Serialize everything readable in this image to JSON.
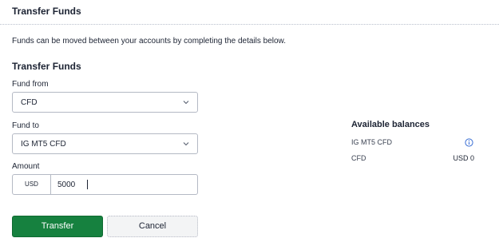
{
  "header": {
    "title": "Transfer Funds"
  },
  "description": "Funds can be moved between your accounts by completing the details below.",
  "form": {
    "section_title": "Transfer Funds",
    "fund_from": {
      "label": "Fund from",
      "value": "CFD"
    },
    "fund_to": {
      "label": "Fund to",
      "value": "IG MT5 CFD"
    },
    "amount": {
      "label": "Amount",
      "currency": "USD",
      "value": "5000"
    },
    "transfer_label": "Transfer",
    "cancel_label": "Cancel"
  },
  "balances": {
    "title": "Available balances",
    "items": [
      {
        "name": "IG MT5 CFD",
        "value": "",
        "icon": "info-icon"
      },
      {
        "name": "CFD",
        "value": "USD 0"
      }
    ]
  },
  "colors": {
    "primary_button": "#16813f",
    "info_icon": "#3b6fd4"
  }
}
